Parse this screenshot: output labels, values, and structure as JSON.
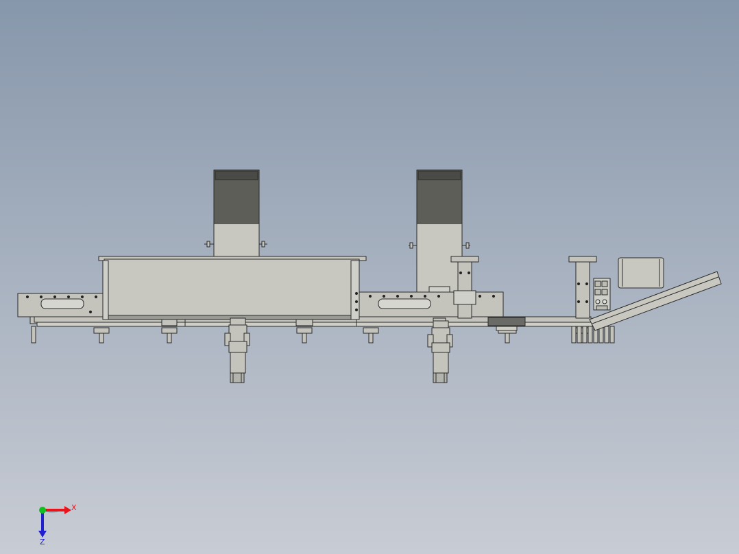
{
  "viewport": {
    "background_top": "#8797ab",
    "background_bottom": "#c8ccd4"
  },
  "model": {
    "body_color": "#c4c4bc",
    "edge_color": "#2a2a2a",
    "motor_cap_color": "#5e5e58",
    "dark_block_color": "#6a6a66"
  },
  "triad": {
    "x_label": "X",
    "z_label": "Z",
    "x_color": "#e8141c",
    "y_color": "#10c020",
    "z_color": "#2020d0"
  }
}
